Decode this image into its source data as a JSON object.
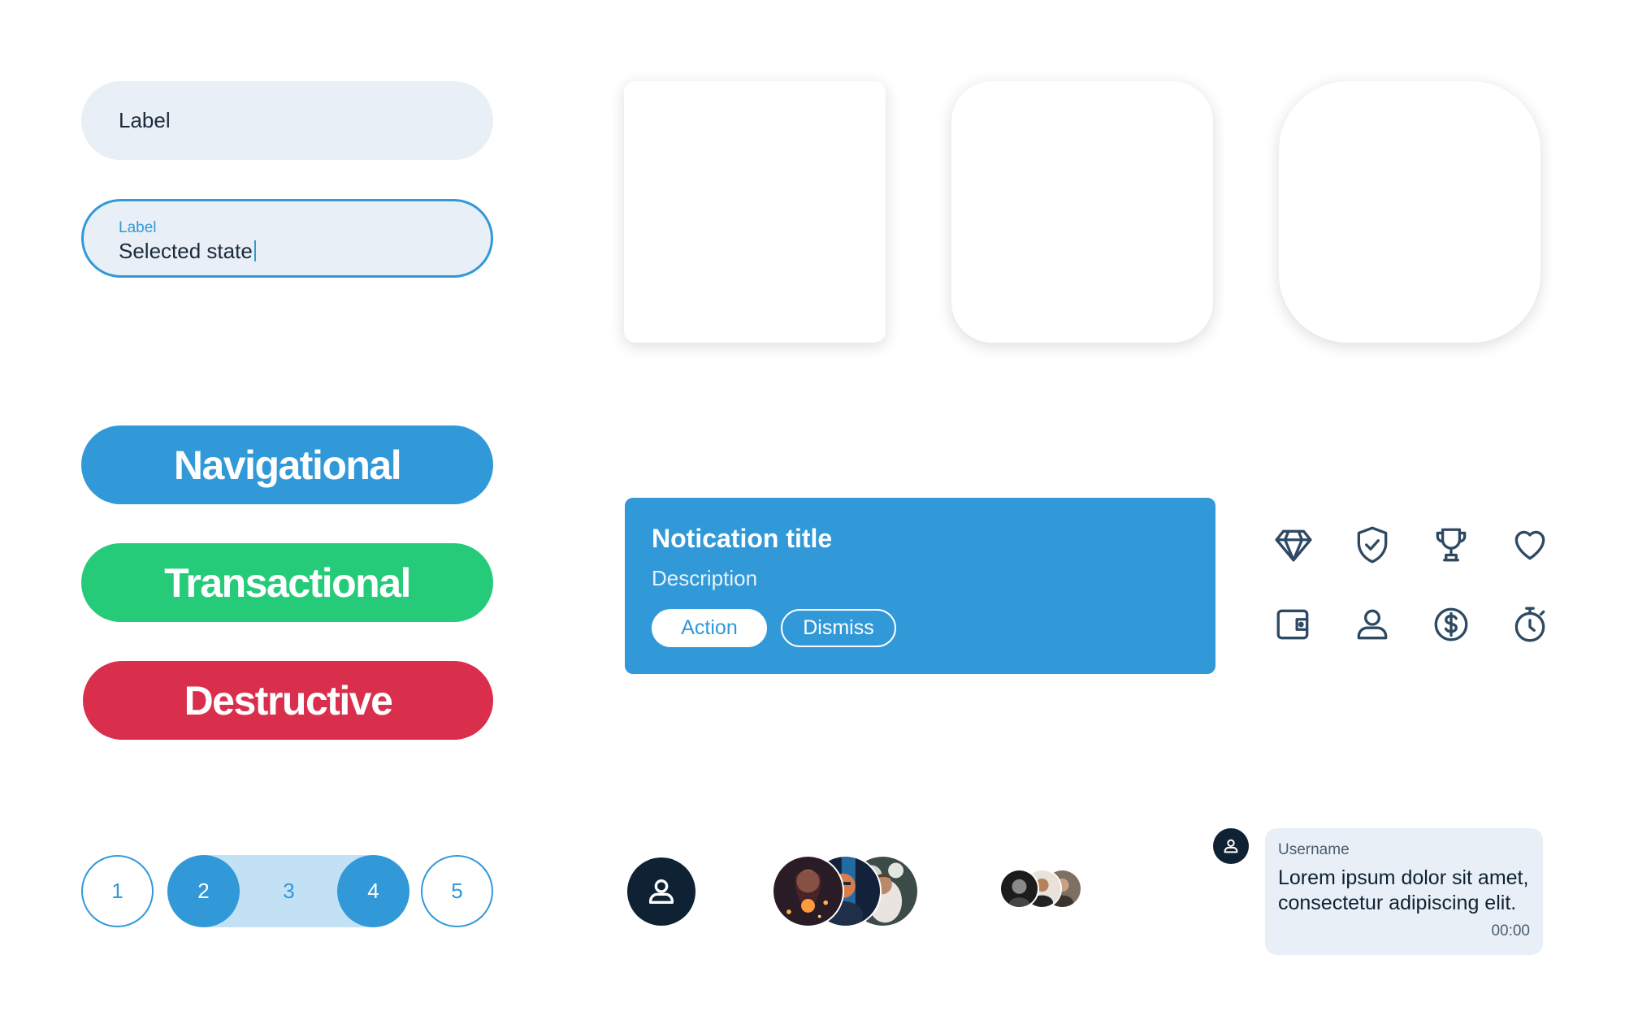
{
  "inputs": {
    "default": {
      "label": "Label"
    },
    "selected": {
      "label": "Label",
      "value": "Selected state"
    }
  },
  "buttons": {
    "navigational": "Navigational",
    "transactional": "Transactional",
    "destructive": "Destructive"
  },
  "notification": {
    "title": "Notication title",
    "description": "Description",
    "action_label": "Action",
    "dismiss_label": "Dismiss"
  },
  "icons": [
    "diamond-icon",
    "shield-check-icon",
    "trophy-icon",
    "heart-icon",
    "wallet-icon",
    "user-icon",
    "dollar-coin-icon",
    "stopwatch-icon"
  ],
  "pagination": {
    "pages": [
      "1",
      "2",
      "3",
      "4",
      "5"
    ],
    "range_start": "2",
    "range_end": "4"
  },
  "chat": {
    "username": "Username",
    "message": "Lorem ipsum dolor sit amet, consectetur adipiscing elit.",
    "time": "00:00"
  },
  "colors": {
    "primary": "#3299d8",
    "success": "#25cb79",
    "danger": "#d92f4c",
    "dark": "#0f2233",
    "field_bg": "#e9eff6",
    "range_bg": "#c3e1f5",
    "icon": "#2e4a63"
  }
}
